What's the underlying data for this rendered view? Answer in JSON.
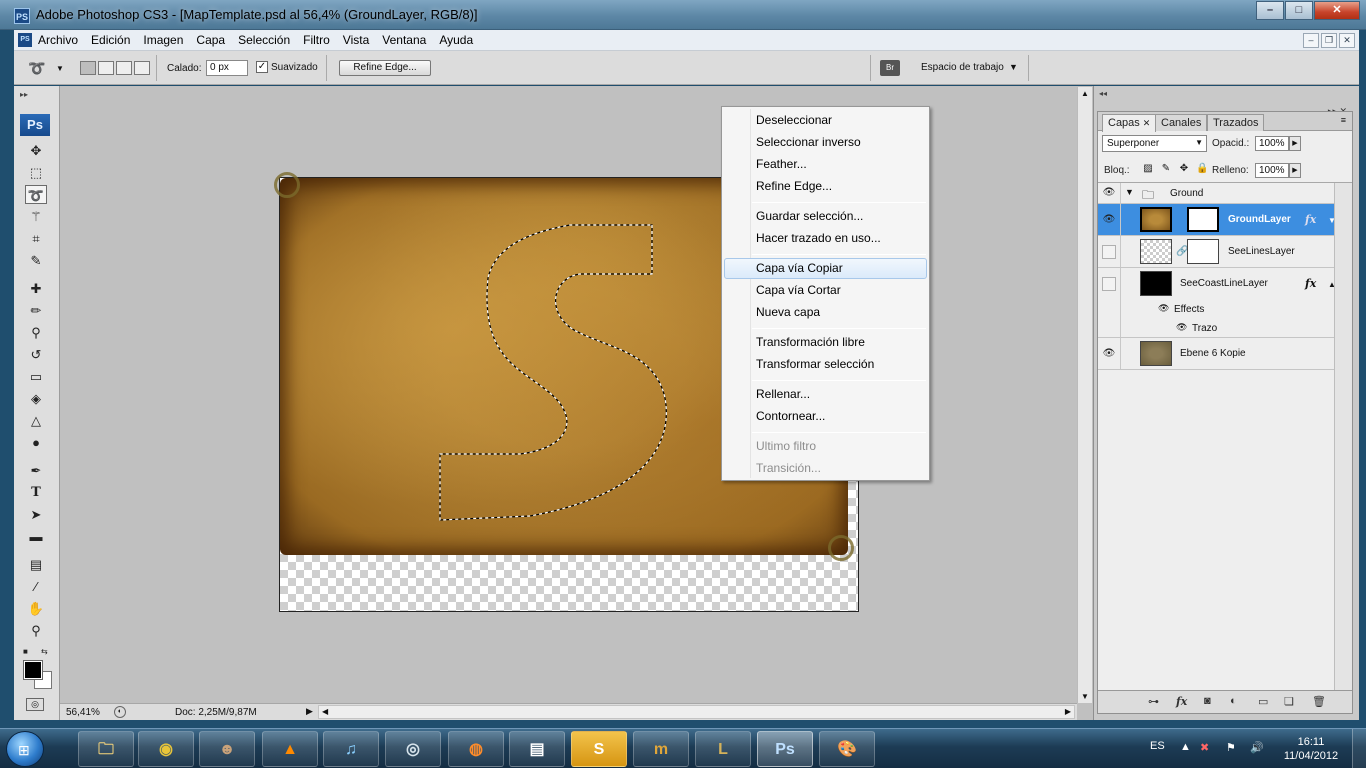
{
  "window": {
    "app_icon": "PS",
    "title": "Adobe Photoshop CS3 - [MapTemplate.psd al 56,4% (GroundLayer, RGB/8)]",
    "controls": [
      "minimize-icon",
      "maximize-icon",
      "close-icon"
    ]
  },
  "menubar": {
    "items": [
      "Archivo",
      "Edición",
      "Imagen",
      "Capa",
      "Selección",
      "Filtro",
      "Vista",
      "Ventana",
      "Ayuda"
    ]
  },
  "options": {
    "calado_label": "Calado:",
    "calado_value": "0 px",
    "suavizado_label": "Suavizado",
    "suavizado_checked": true,
    "refine_edge_label": "Refine Edge...",
    "workspace_label": "Espacio de trabajo"
  },
  "tools": {
    "logo": "Ps",
    "items": [
      "move-tool-icon",
      "marquee-tool-icon",
      "lasso-tool-icon",
      "magic-wand-icon",
      "crop-tool-icon",
      "slice-tool-icon",
      "healing-brush-icon",
      "brush-tool-icon",
      "clone-stamp-icon",
      "history-brush-icon",
      "eraser-icon",
      "paint-bucket-icon",
      "blur-tool-icon",
      "dodge-tool-icon",
      "pen-tool-icon",
      "type-tool-icon",
      "path-selection-icon",
      "shape-tool-icon",
      "notes-tool-icon",
      "eyedropper-icon",
      "hand-tool-icon",
      "zoom-tool-icon"
    ],
    "active": "lasso-tool-icon",
    "foreground_color": "#000000",
    "background_color": "#ffffff"
  },
  "context_menu": {
    "highlighted": "Capa vía Copiar",
    "groups": [
      [
        "Deseleccionar",
        "Seleccionar inverso",
        "Feather...",
        "Refine Edge..."
      ],
      [
        "Guardar selección...",
        "Hacer trazado en uso..."
      ],
      [
        "Capa vía Copiar",
        "Capa vía Cortar",
        "Nueva capa"
      ],
      [
        "Transformación libre",
        "Transformar selección"
      ],
      [
        "Rellenar...",
        "Contornear..."
      ],
      [
        "Ultimo filtro",
        "Transición..."
      ]
    ],
    "disabled": [
      "Ultimo filtro",
      "Transición..."
    ]
  },
  "statusbar": {
    "zoom": "56,41%",
    "doc": "Doc: 2,25M/9,87M"
  },
  "layers": {
    "tabs": [
      "Capas",
      "Canales",
      "Trazados"
    ],
    "active_tab": "Capas",
    "blend_mode": "Superponer",
    "opacity_label": "Opacid.:",
    "opacity_value": "100%",
    "lock_label": "Bloq.:",
    "fill_label": "Relleno:",
    "fill_value": "100%",
    "group_name": "Ground",
    "rows": [
      {
        "name": "GroundLayer",
        "visible": true,
        "selected": true,
        "fx": true
      },
      {
        "name": "SeeLinesLayer",
        "visible": false,
        "selected": false,
        "fx": false
      },
      {
        "name": "SeeCoastLineLayer",
        "visible": false,
        "selected": false,
        "fx": true
      }
    ],
    "effects_label": "Effects",
    "effect_item": "Trazo",
    "bottom_layer": "Ebene 6 Kopie",
    "fx_label": "fx"
  },
  "taskbar": {
    "apps": [
      "explorer-icon",
      "chrome-icon",
      "game-icon",
      "vlc-icon",
      "itunes-icon",
      "steam-icon",
      "firefox-icon",
      "notepad-icon",
      "skype-icon",
      "mumble-icon",
      "league-icon",
      "photoshop-icon",
      "paint-icon"
    ],
    "active_app": "photoshop-icon",
    "lang": "ES",
    "time": "16:11",
    "date": "11/04/2012"
  }
}
